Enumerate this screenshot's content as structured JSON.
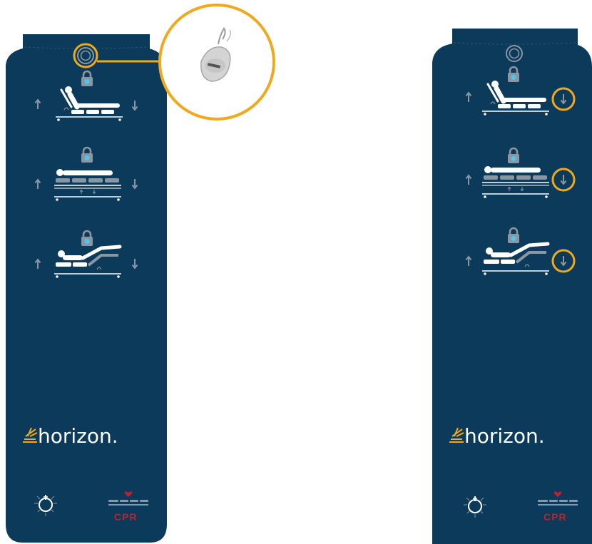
{
  "colors": {
    "panel": "#0b3a5b",
    "highlight": "#f0a91e",
    "led": "#4cc7f0",
    "gray": "#8a97a3",
    "cpr": "#c3202e",
    "logo_accent": "#f0a91e"
  },
  "brand": {
    "name": "horizon."
  },
  "cpr": {
    "label": "CPR"
  },
  "icons": {
    "key": "key-icon",
    "lock": "lock-icon",
    "arrow_up": "arrow-up-icon",
    "arrow_down": "arrow-down-icon",
    "bed": "bed-position-icon",
    "night_light": "night-light-icon",
    "heart": "heart-icon",
    "keyfob": "rfid-keyfob-icon"
  },
  "left_panel": {
    "highlight": "key-reader",
    "controls": [
      "backrest",
      "bed-height",
      "legrest"
    ]
  },
  "right_panel": {
    "highlight": "down-arrows",
    "controls": [
      "backrest",
      "bed-height",
      "legrest"
    ]
  }
}
